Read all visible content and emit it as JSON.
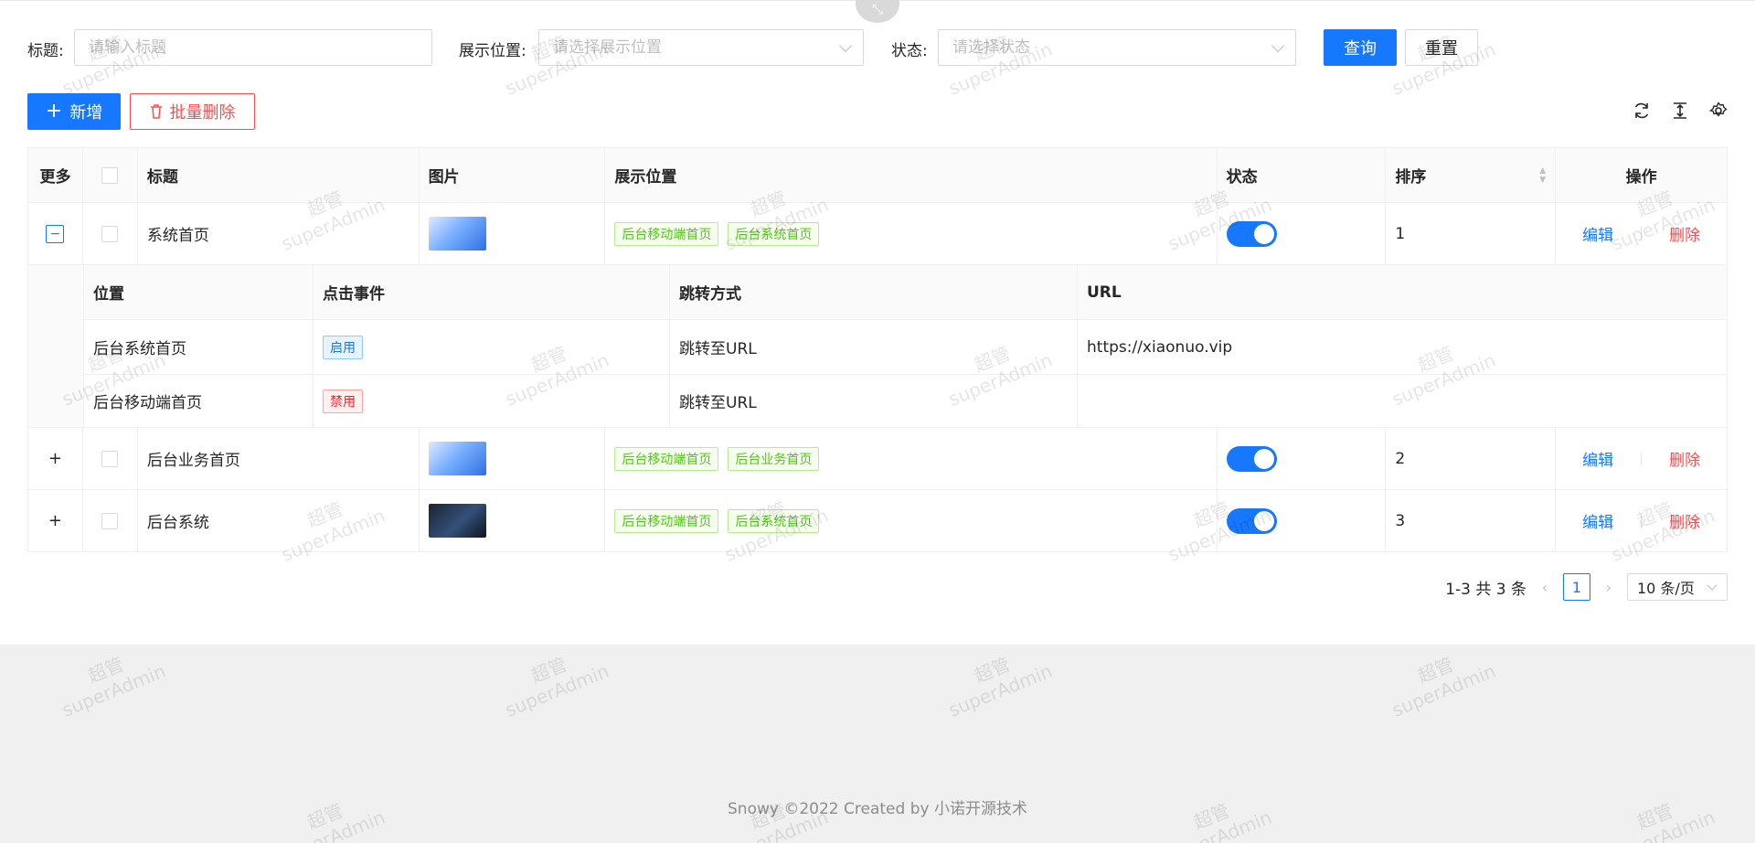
{
  "search": {
    "title_label": "标题:",
    "title_placeholder": "请输入标题",
    "position_label": "展示位置:",
    "position_placeholder": "请选择展示位置",
    "status_label": "状态:",
    "status_placeholder": "请选择状态",
    "query_button": "查询",
    "reset_button": "重置"
  },
  "toolbar": {
    "add_button": "新增",
    "batch_delete_button": "批量删除",
    "icons": [
      "refresh-icon",
      "column-height-icon",
      "setting-icon"
    ]
  },
  "table": {
    "headers": {
      "more": "更多",
      "title": "标题",
      "image": "图片",
      "position": "展示位置",
      "status": "状态",
      "sort": "排序",
      "actions": "操作"
    },
    "rows": [
      {
        "title": "系统首页",
        "thumb": "blue",
        "tags": [
          "后台移动端首页",
          "后台系统首页"
        ],
        "status_on": true,
        "sort": "1",
        "edit": "编辑",
        "delete": "删除",
        "expanded": true
      },
      {
        "title": "后台业务首页",
        "thumb": "blue",
        "tags": [
          "后台移动端首页",
          "后台业务首页"
        ],
        "status_on": true,
        "sort": "2",
        "edit": "编辑",
        "delete": "删除",
        "expanded": false
      },
      {
        "title": "后台系统",
        "thumb": "dark",
        "tags": [
          "后台移动端首页",
          "后台系统首页"
        ],
        "status_on": true,
        "sort": "3",
        "edit": "编辑",
        "delete": "删除",
        "expanded": false
      }
    ],
    "sub_table": {
      "headers": {
        "position": "位置",
        "click_event": "点击事件",
        "jump_mode": "跳转方式",
        "url": "URL"
      },
      "rows": [
        {
          "position": "后台系统首页",
          "click_event": "启用",
          "jump_mode": "跳转至URL",
          "url": "https://xiaonuo.vip"
        },
        {
          "position": "后台移动端首页",
          "click_event": "禁用",
          "jump_mode": "跳转至URL",
          "url": ""
        }
      ]
    }
  },
  "pagination": {
    "summary": "1-3 共 3 条",
    "current_page": "1",
    "page_size": "10 条/页"
  },
  "footer": {
    "text": "Snowy ©2022 Created by 小诺开源技术"
  },
  "watermark": {
    "line1": "超管",
    "line2": "superAdmin"
  },
  "colors": {
    "primary": "#1677ff",
    "danger": "#ff4d4f",
    "tag_green": "#52c41a"
  }
}
